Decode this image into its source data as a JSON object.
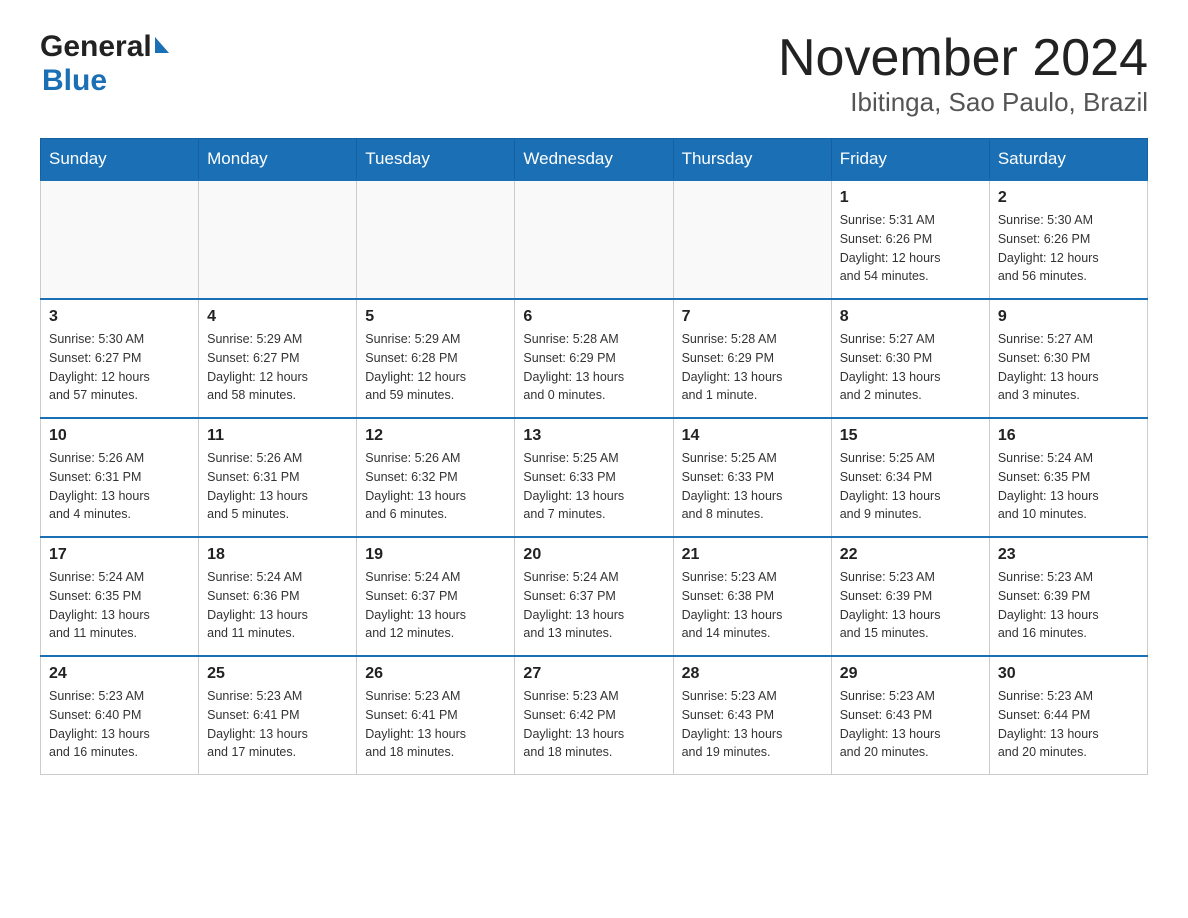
{
  "header": {
    "title": "November 2024",
    "subtitle": "Ibitinga, Sao Paulo, Brazil",
    "logo_general": "General",
    "logo_blue": "Blue"
  },
  "days_of_week": [
    "Sunday",
    "Monday",
    "Tuesday",
    "Wednesday",
    "Thursday",
    "Friday",
    "Saturday"
  ],
  "weeks": [
    [
      {
        "day": "",
        "info": ""
      },
      {
        "day": "",
        "info": ""
      },
      {
        "day": "",
        "info": ""
      },
      {
        "day": "",
        "info": ""
      },
      {
        "day": "",
        "info": ""
      },
      {
        "day": "1",
        "info": "Sunrise: 5:31 AM\nSunset: 6:26 PM\nDaylight: 12 hours\nand 54 minutes."
      },
      {
        "day": "2",
        "info": "Sunrise: 5:30 AM\nSunset: 6:26 PM\nDaylight: 12 hours\nand 56 minutes."
      }
    ],
    [
      {
        "day": "3",
        "info": "Sunrise: 5:30 AM\nSunset: 6:27 PM\nDaylight: 12 hours\nand 57 minutes."
      },
      {
        "day": "4",
        "info": "Sunrise: 5:29 AM\nSunset: 6:27 PM\nDaylight: 12 hours\nand 58 minutes."
      },
      {
        "day": "5",
        "info": "Sunrise: 5:29 AM\nSunset: 6:28 PM\nDaylight: 12 hours\nand 59 minutes."
      },
      {
        "day": "6",
        "info": "Sunrise: 5:28 AM\nSunset: 6:29 PM\nDaylight: 13 hours\nand 0 minutes."
      },
      {
        "day": "7",
        "info": "Sunrise: 5:28 AM\nSunset: 6:29 PM\nDaylight: 13 hours\nand 1 minute."
      },
      {
        "day": "8",
        "info": "Sunrise: 5:27 AM\nSunset: 6:30 PM\nDaylight: 13 hours\nand 2 minutes."
      },
      {
        "day": "9",
        "info": "Sunrise: 5:27 AM\nSunset: 6:30 PM\nDaylight: 13 hours\nand 3 minutes."
      }
    ],
    [
      {
        "day": "10",
        "info": "Sunrise: 5:26 AM\nSunset: 6:31 PM\nDaylight: 13 hours\nand 4 minutes."
      },
      {
        "day": "11",
        "info": "Sunrise: 5:26 AM\nSunset: 6:31 PM\nDaylight: 13 hours\nand 5 minutes."
      },
      {
        "day": "12",
        "info": "Sunrise: 5:26 AM\nSunset: 6:32 PM\nDaylight: 13 hours\nand 6 minutes."
      },
      {
        "day": "13",
        "info": "Sunrise: 5:25 AM\nSunset: 6:33 PM\nDaylight: 13 hours\nand 7 minutes."
      },
      {
        "day": "14",
        "info": "Sunrise: 5:25 AM\nSunset: 6:33 PM\nDaylight: 13 hours\nand 8 minutes."
      },
      {
        "day": "15",
        "info": "Sunrise: 5:25 AM\nSunset: 6:34 PM\nDaylight: 13 hours\nand 9 minutes."
      },
      {
        "day": "16",
        "info": "Sunrise: 5:24 AM\nSunset: 6:35 PM\nDaylight: 13 hours\nand 10 minutes."
      }
    ],
    [
      {
        "day": "17",
        "info": "Sunrise: 5:24 AM\nSunset: 6:35 PM\nDaylight: 13 hours\nand 11 minutes."
      },
      {
        "day": "18",
        "info": "Sunrise: 5:24 AM\nSunset: 6:36 PM\nDaylight: 13 hours\nand 11 minutes."
      },
      {
        "day": "19",
        "info": "Sunrise: 5:24 AM\nSunset: 6:37 PM\nDaylight: 13 hours\nand 12 minutes."
      },
      {
        "day": "20",
        "info": "Sunrise: 5:24 AM\nSunset: 6:37 PM\nDaylight: 13 hours\nand 13 minutes."
      },
      {
        "day": "21",
        "info": "Sunrise: 5:23 AM\nSunset: 6:38 PM\nDaylight: 13 hours\nand 14 minutes."
      },
      {
        "day": "22",
        "info": "Sunrise: 5:23 AM\nSunset: 6:39 PM\nDaylight: 13 hours\nand 15 minutes."
      },
      {
        "day": "23",
        "info": "Sunrise: 5:23 AM\nSunset: 6:39 PM\nDaylight: 13 hours\nand 16 minutes."
      }
    ],
    [
      {
        "day": "24",
        "info": "Sunrise: 5:23 AM\nSunset: 6:40 PM\nDaylight: 13 hours\nand 16 minutes."
      },
      {
        "day": "25",
        "info": "Sunrise: 5:23 AM\nSunset: 6:41 PM\nDaylight: 13 hours\nand 17 minutes."
      },
      {
        "day": "26",
        "info": "Sunrise: 5:23 AM\nSunset: 6:41 PM\nDaylight: 13 hours\nand 18 minutes."
      },
      {
        "day": "27",
        "info": "Sunrise: 5:23 AM\nSunset: 6:42 PM\nDaylight: 13 hours\nand 18 minutes."
      },
      {
        "day": "28",
        "info": "Sunrise: 5:23 AM\nSunset: 6:43 PM\nDaylight: 13 hours\nand 19 minutes."
      },
      {
        "day": "29",
        "info": "Sunrise: 5:23 AM\nSunset: 6:43 PM\nDaylight: 13 hours\nand 20 minutes."
      },
      {
        "day": "30",
        "info": "Sunrise: 5:23 AM\nSunset: 6:44 PM\nDaylight: 13 hours\nand 20 minutes."
      }
    ]
  ]
}
